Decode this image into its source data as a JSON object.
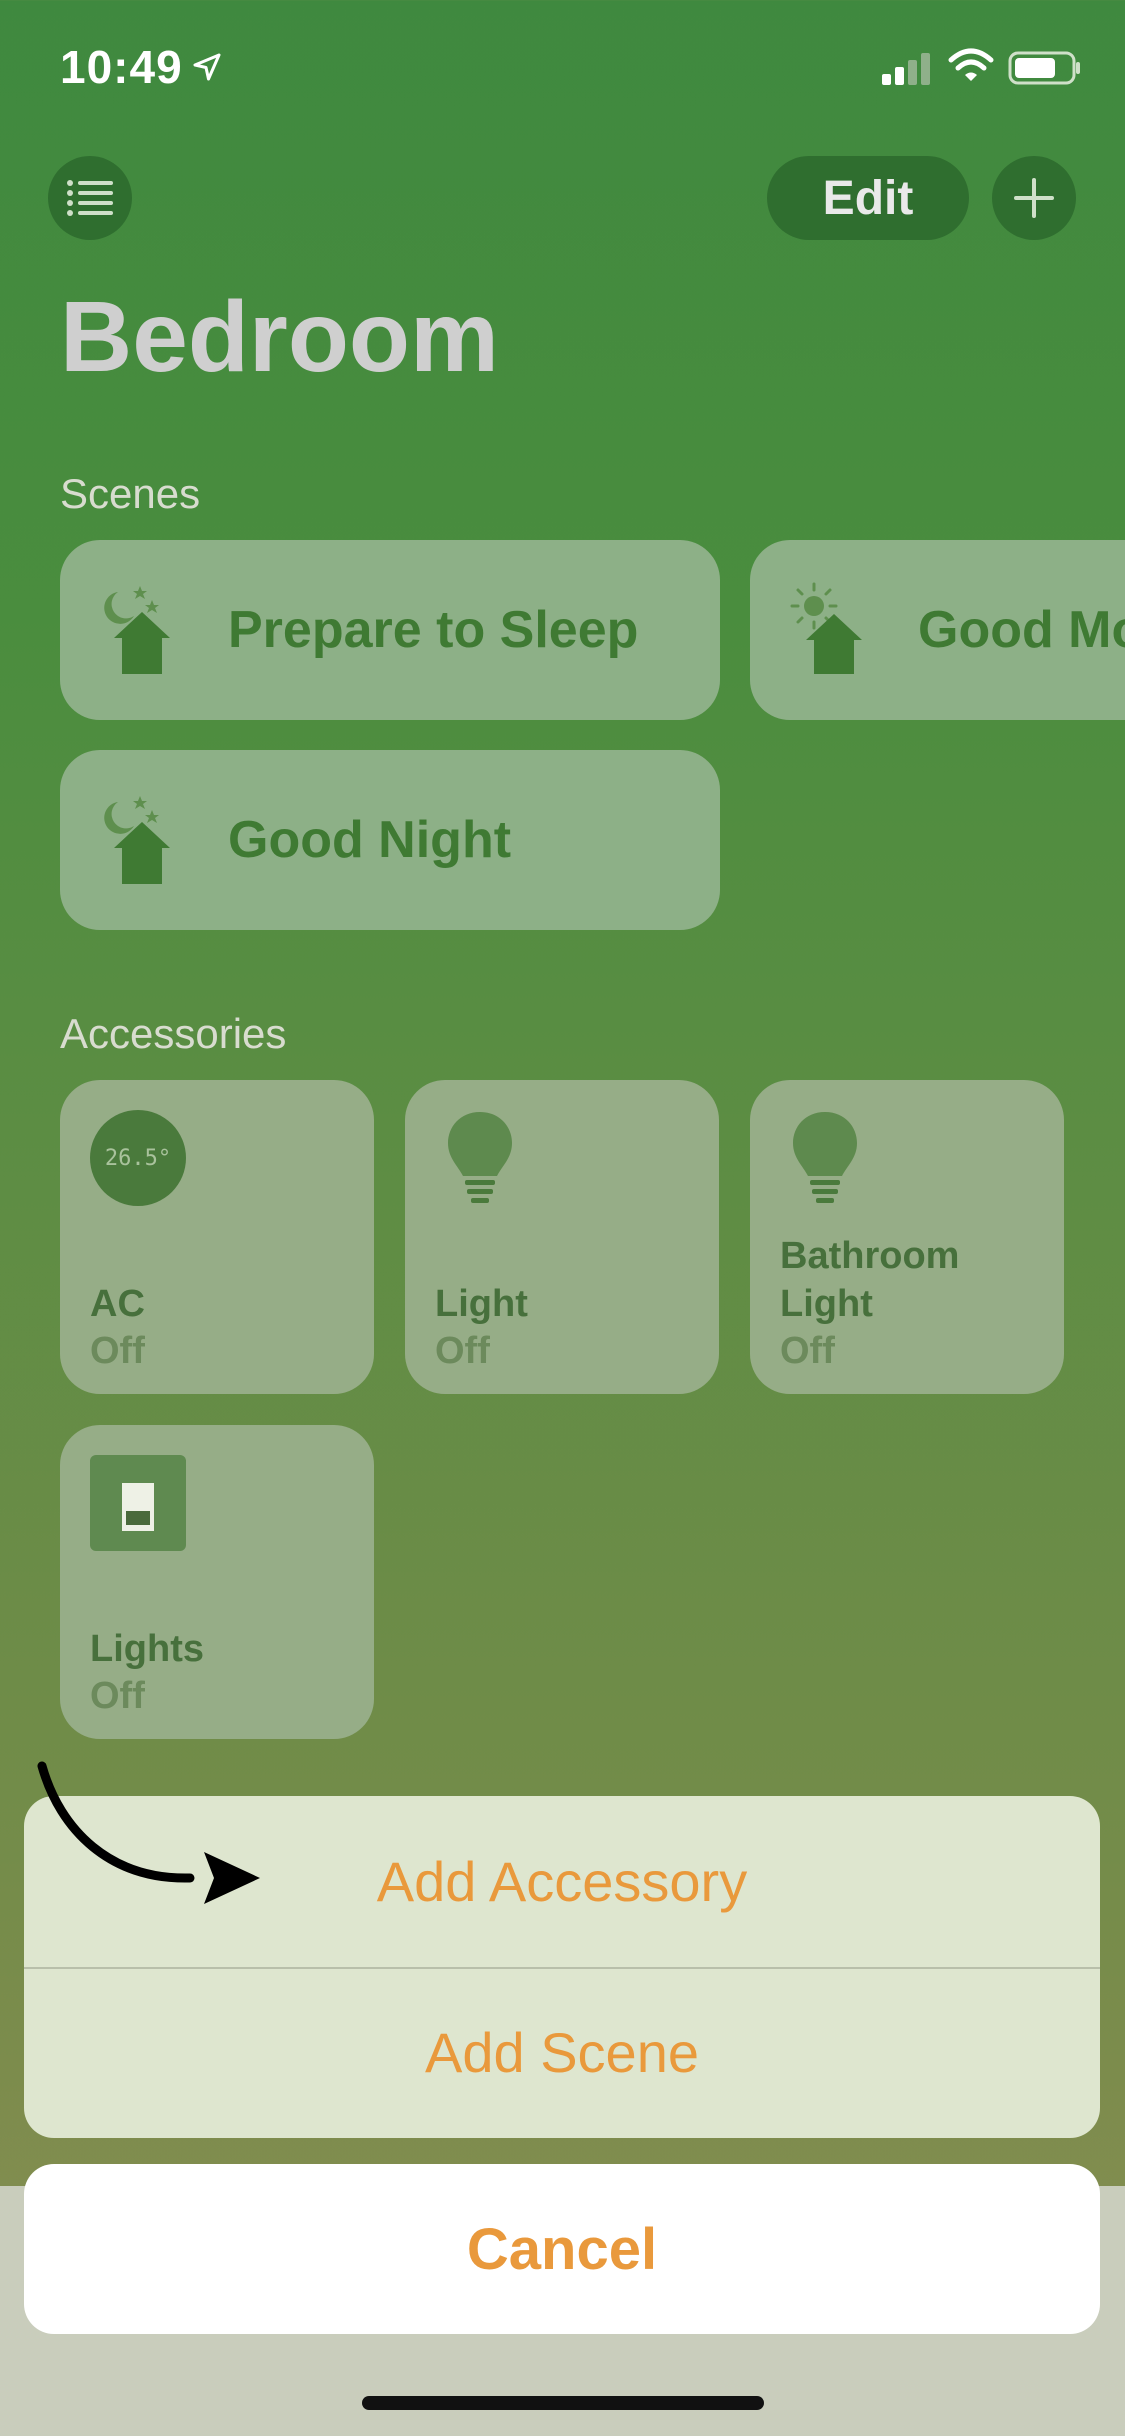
{
  "status_bar": {
    "time": "10:49"
  },
  "nav": {
    "edit_label": "Edit"
  },
  "page": {
    "title": "Bedroom"
  },
  "scenes": {
    "title": "Scenes",
    "items": [
      {
        "label": "Prepare to Sleep",
        "icon": "moon-home-icon"
      },
      {
        "label": "Good Mo",
        "icon": "sun-home-icon"
      },
      {
        "label": "Good Night",
        "icon": "moon-home-icon"
      }
    ]
  },
  "accessories": {
    "title": "Accessories",
    "items": [
      {
        "name": "AC",
        "status": "Off",
        "reading": "26.5°",
        "icon": "thermostat-icon"
      },
      {
        "name": "Light",
        "status": "Off",
        "icon": "lightbulb-icon"
      },
      {
        "name": "Bathroom Light",
        "status": "Off",
        "icon": "lightbulb-icon"
      },
      {
        "name": "Lights",
        "status": "Off",
        "icon": "switch-icon"
      }
    ]
  },
  "action_sheet": {
    "items": [
      "Add Accessory",
      "Add Scene"
    ],
    "cancel_label": "Cancel"
  },
  "colors": {
    "accent": "#e9993c",
    "card": "#8db087",
    "nav_button": "#2f6e2f"
  }
}
